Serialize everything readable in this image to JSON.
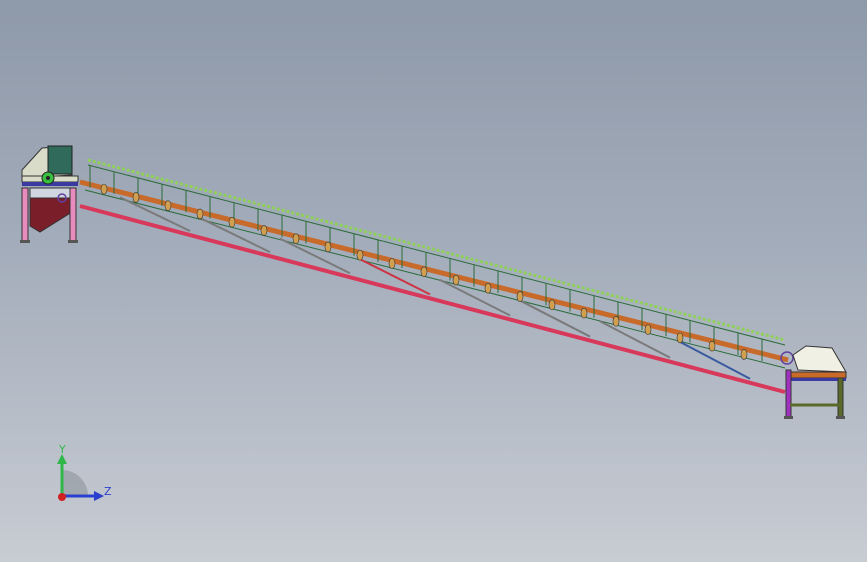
{
  "viewport": {
    "background_top": "#8e99a9",
    "background_bottom": "#c8ccd3"
  },
  "model": {
    "type": "inclined belt conveyor assembly",
    "colors": {
      "belt_top": "#8fd05a",
      "upper_rail": "#c86a2a",
      "lower_rail": "#d8385a",
      "frame_line": "#2b6b3a",
      "idler_roller": "#d0a050",
      "brace": "#7a7a7a",
      "brace_accent_red": "#cc3344",
      "brace_accent_blue": "#3a5aa0",
      "hopper_body": "#7a1e2a",
      "hopper_cover": "#d8dcc8",
      "hopper_panel": "#2f6a5a",
      "leg_pink": "#e88cc0",
      "leg_purple": "#a030c0",
      "tail_frame": "#c86a2a",
      "tail_legs": "#5a6a2a"
    }
  },
  "triad": {
    "y_label": "Y",
    "z_label": "Z",
    "y_color": "#2fb84a",
    "z_color": "#2a3fd0",
    "x_color": "#d02020"
  }
}
